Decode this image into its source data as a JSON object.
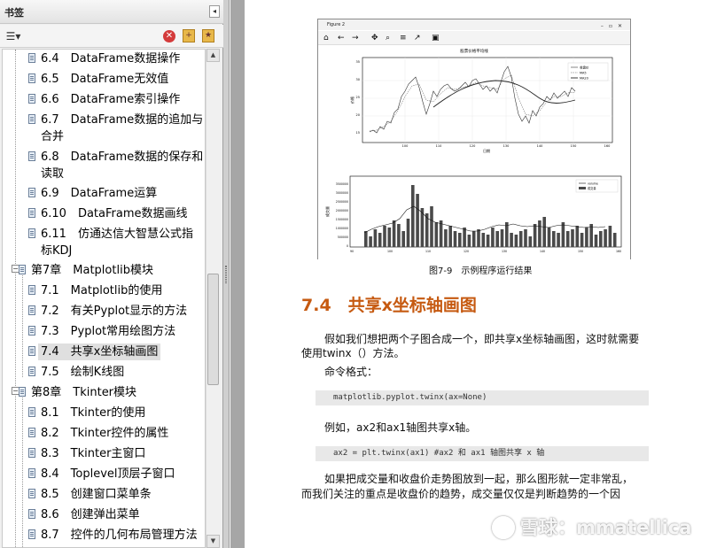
{
  "bookmarks_panel": {
    "title": "书签",
    "collapse_symbol": "◂",
    "items": [
      {
        "label": "6.4　DataFrame数据操作"
      },
      {
        "label": "6.5　DataFrame无效值"
      },
      {
        "label": "6.6　DataFrame索引操作"
      },
      {
        "label": "6.7　DataFrame数据的追加与",
        "label2": "合并"
      },
      {
        "label": "6.8　DataFrame数据的保存和",
        "label2": "读取"
      },
      {
        "label": "6.9　DataFrame运算"
      },
      {
        "label": "6.10　DataFrame数据画线"
      },
      {
        "label": "6.11　仿通达信大智慧公式指",
        "label2": "标KDJ"
      },
      {
        "label": "第7章　Matplotlib模块"
      },
      {
        "label": "7.1　Matplotlib的使用"
      },
      {
        "label": "7.2　有关Pyplot显示的方法"
      },
      {
        "label": "7.3　Pyplot常用绘图方法"
      },
      {
        "label": "7.4　共享x坐标轴画图"
      },
      {
        "label": "7.5　绘制K线图"
      },
      {
        "label": "第8章　Tkinter模块"
      },
      {
        "label": "8.1　Tkinter的使用"
      },
      {
        "label": "8.2　Tkinter控件的属性"
      },
      {
        "label": "8.3　Tkinter主窗口"
      },
      {
        "label": "8.4　Toplevel顶层子窗口"
      },
      {
        "label": "8.5　创建窗口菜单条"
      },
      {
        "label": "8.6　创建弹出菜单"
      },
      {
        "label": "8.7　控件的几何布局管理方法"
      }
    ]
  },
  "figure_window": {
    "title": "Figure 2",
    "plot_title": "股票价格平均线",
    "top_xlabel": "日期",
    "top_ylabel": "价格",
    "bottom_ylabel": "成交量",
    "top_legend": [
      "收盘价",
      "MA5",
      "MA20"
    ],
    "bottom_legend": [
      "volume",
      "成交量"
    ],
    "top_xticks": [
      "100",
      "110",
      "120",
      "130",
      "140",
      "150",
      "160"
    ],
    "bottom_xticks": [
      "90",
      "100",
      "110",
      "120",
      "130",
      "140",
      "150",
      "160"
    ],
    "top_yticks": [
      "15",
      "20",
      "25",
      "30",
      "35"
    ],
    "bottom_yticks": [
      "0",
      "500000",
      "1000000",
      "1500000",
      "2000000",
      "2500000",
      "3000000",
      "3500000"
    ],
    "toolbar_icons": [
      "home-icon",
      "back-icon",
      "forward-icon",
      "pan-icon",
      "zoom-icon",
      "configure-icon",
      "edit-icon",
      "save-icon"
    ]
  },
  "document": {
    "figure_caption": "图7-9　示例程序运行结果",
    "section_title": "7.4　共享x坐标轴画图",
    "para1_line1": "假如我们想把两个子图合成一个，即共享x坐标轴画图，这时就需要",
    "para1_line2": "使用twinx（）方法。",
    "command_format_label": "命令格式：",
    "code1": "matplotlib.pyplot.twinx(ax=None)",
    "para2": "例如，ax2和ax1轴图共享x轴。",
    "code2": "ax2 = plt.twinx(ax1)  #ax2 和 ax1 轴图共享 x 轴",
    "para3_line1": "如果把成交量和收盘价走势图放到一起，那么图形就一定非常乱，",
    "para3_line2": "而我们关注的重点是收盘价的趋势，成交量仅仅是判断趋势的一个因"
  },
  "watermark": "雪球：mmatellica",
  "colors": {
    "section_title": "#c65a11",
    "panel_bg": "#f0f0f0",
    "doc_bg": "#a6a6a6"
  }
}
